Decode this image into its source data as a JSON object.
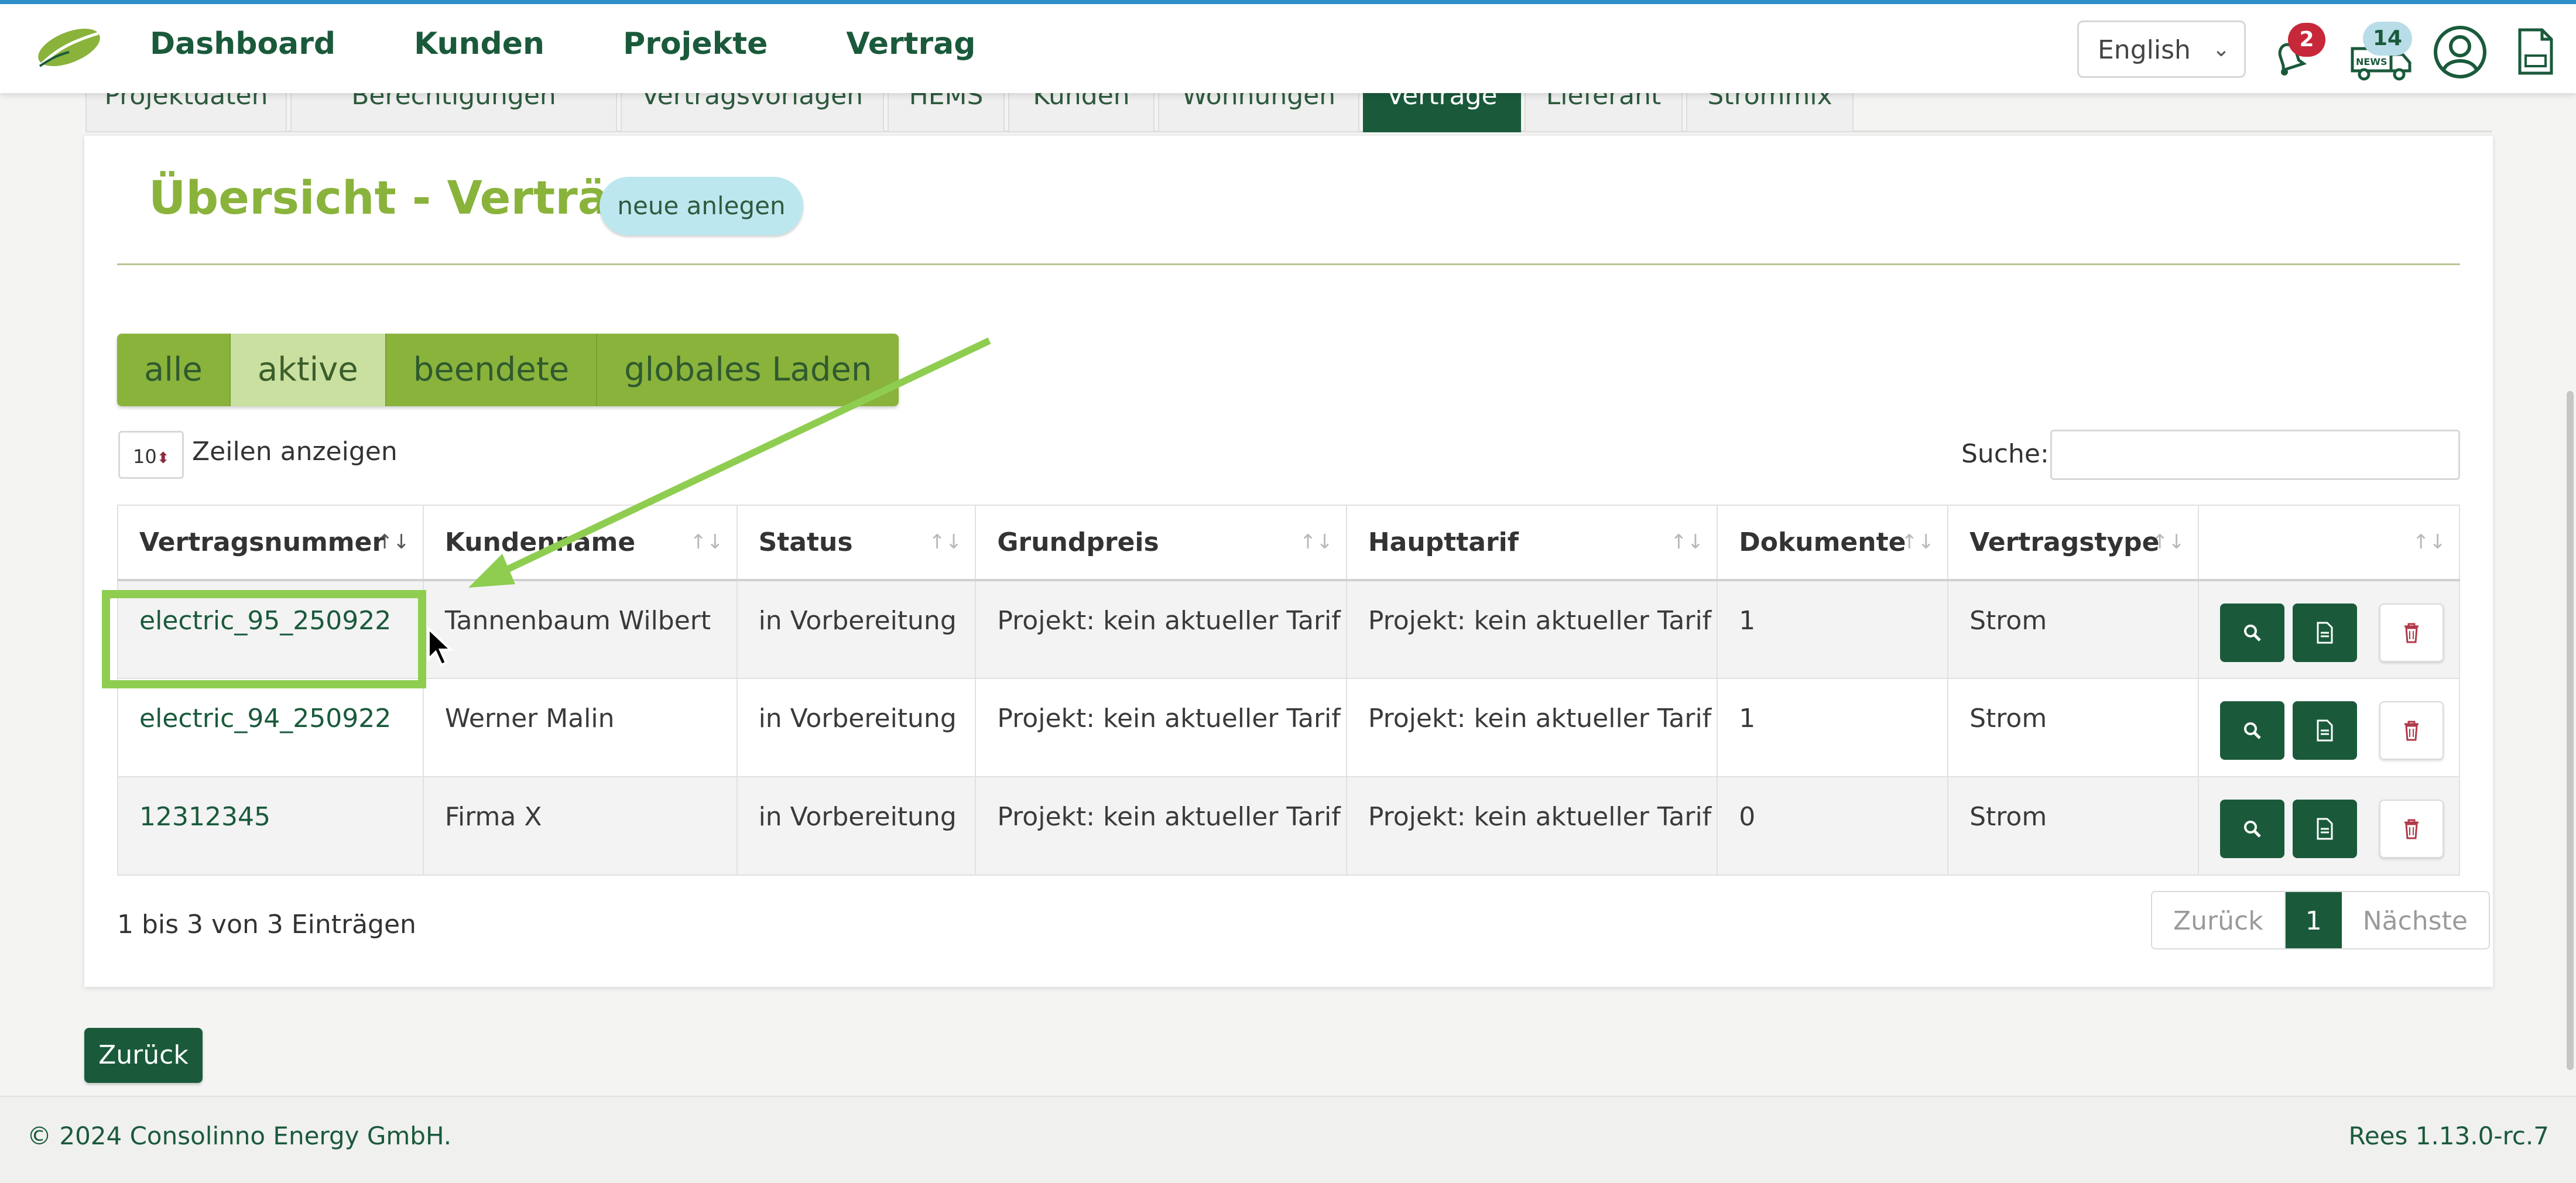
{
  "header": {
    "nav": [
      "Dashboard",
      "Kunden",
      "Projekte",
      "Vertrag"
    ],
    "language": "English",
    "notification_count": "2",
    "news_count": "14",
    "news_label": "NEWS"
  },
  "tabs": [
    "Projektdaten",
    "Berechtigungen",
    "Vertragsvorlagen",
    "HEMS",
    "Kunden",
    "Wohnungen",
    "Verträge",
    "Lieferant",
    "Strommix"
  ],
  "active_tab": "Verträge",
  "page": {
    "title": "Übersicht - Verträge",
    "new_button": "neue anlegen",
    "filters": [
      "alle",
      "aktive",
      "beendete",
      "globales Laden"
    ],
    "active_filter": "aktive",
    "page_length": "10",
    "page_length_label": "Zeilen anzeigen",
    "search_label": "Suche:",
    "search_value": ""
  },
  "table": {
    "columns": [
      "Vertragsnummer",
      "Kundenname",
      "Status",
      "Grundpreis",
      "Haupttarif",
      "Dokumente",
      "Vertragstype",
      ""
    ],
    "rows": [
      [
        "electric_95_250922",
        "Tannenbaum Wilbert",
        "in Vorbereitung",
        "Projekt: kein aktueller Tarif",
        "Projekt: kein aktueller Tarif",
        "1",
        "Strom"
      ],
      [
        "electric_94_250922",
        "Werner Malin",
        "in Vorbereitung",
        "Projekt: kein aktueller Tarif",
        "Projekt: kein aktueller Tarif",
        "1",
        "Strom"
      ],
      [
        "12312345",
        "Firma X",
        "in Vorbereitung",
        "Projekt: kein aktueller Tarif",
        "Projekt: kein aktueller Tarif",
        "0",
        "Strom"
      ]
    ]
  },
  "pagination": {
    "info": "1 bis 3 von 3 Einträgen",
    "prev": "Zurück",
    "current": "1",
    "next": "Nächste"
  },
  "back_button": "Zurück",
  "footer": {
    "copyright": "© 2024 Consolinno Energy GmbH.",
    "version": "Rees 1.13.0-rc.7"
  },
  "colors": {
    "brand_dark": "#1a5a3b",
    "brand_green": "#8ab33c",
    "annotation": "#8fcd50"
  },
  "icons": [
    "leaf-logo-icon",
    "bell-icon",
    "news-van-icon",
    "user-avatar-icon",
    "document-icon",
    "search-icon",
    "file-icon",
    "trash-icon",
    "mouse-cursor-icon"
  ]
}
